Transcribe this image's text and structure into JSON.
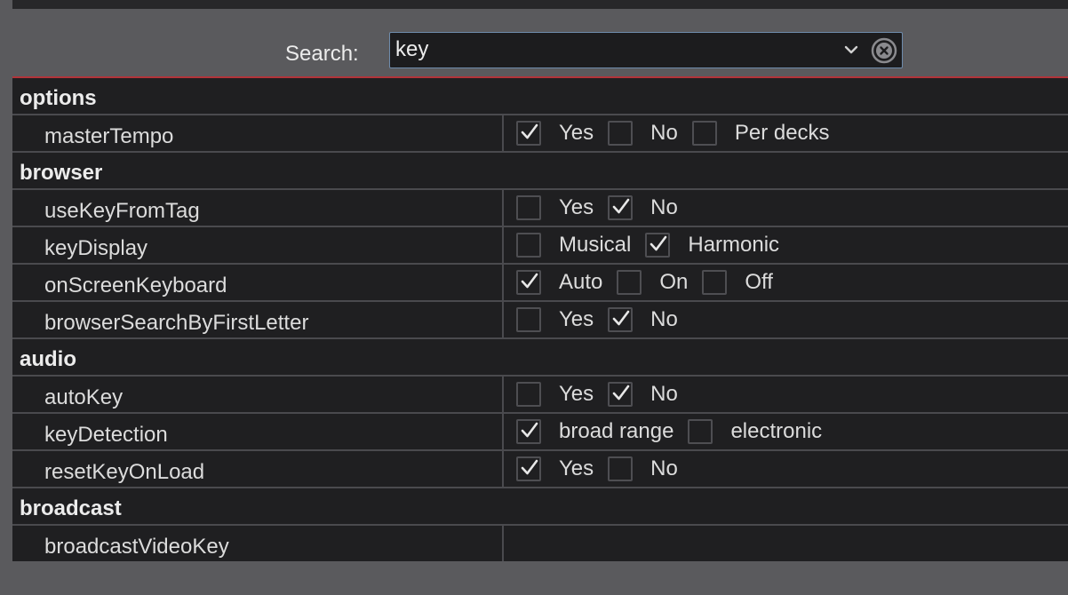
{
  "search": {
    "label": "Search:",
    "value": "key"
  },
  "rows": [
    {
      "type": "section",
      "label": "options"
    },
    {
      "type": "setting",
      "key": "masterTempo",
      "options": [
        {
          "label": "Yes",
          "checked": true
        },
        {
          "label": "No",
          "checked": false
        },
        {
          "label": "Per decks",
          "checked": false
        }
      ]
    },
    {
      "type": "section",
      "label": "browser"
    },
    {
      "type": "setting",
      "key": "useKeyFromTag",
      "options": [
        {
          "label": "Yes",
          "checked": false
        },
        {
          "label": "No",
          "checked": true
        }
      ]
    },
    {
      "type": "setting",
      "key": "keyDisplay",
      "options": [
        {
          "label": "Musical",
          "checked": false
        },
        {
          "label": "Harmonic",
          "checked": true
        }
      ]
    },
    {
      "type": "setting",
      "key": "onScreenKeyboard",
      "options": [
        {
          "label": "Auto",
          "checked": true
        },
        {
          "label": "On",
          "checked": false
        },
        {
          "label": "Off",
          "checked": false
        }
      ]
    },
    {
      "type": "setting",
      "key": "browserSearchByFirstLetter",
      "options": [
        {
          "label": "Yes",
          "checked": false
        },
        {
          "label": "No",
          "checked": true
        }
      ]
    },
    {
      "type": "section",
      "label": "audio"
    },
    {
      "type": "setting",
      "key": "autoKey",
      "options": [
        {
          "label": "Yes",
          "checked": false
        },
        {
          "label": "No",
          "checked": true
        }
      ]
    },
    {
      "type": "setting",
      "key": "keyDetection",
      "options": [
        {
          "label": "broad range",
          "checked": true
        },
        {
          "label": "electronic",
          "checked": false
        }
      ]
    },
    {
      "type": "setting",
      "key": "resetKeyOnLoad",
      "options": [
        {
          "label": "Yes",
          "checked": true
        },
        {
          "label": "No",
          "checked": false
        }
      ]
    },
    {
      "type": "section",
      "label": "broadcast"
    },
    {
      "type": "setting",
      "key": "broadcastVideoKey",
      "options": []
    }
  ]
}
